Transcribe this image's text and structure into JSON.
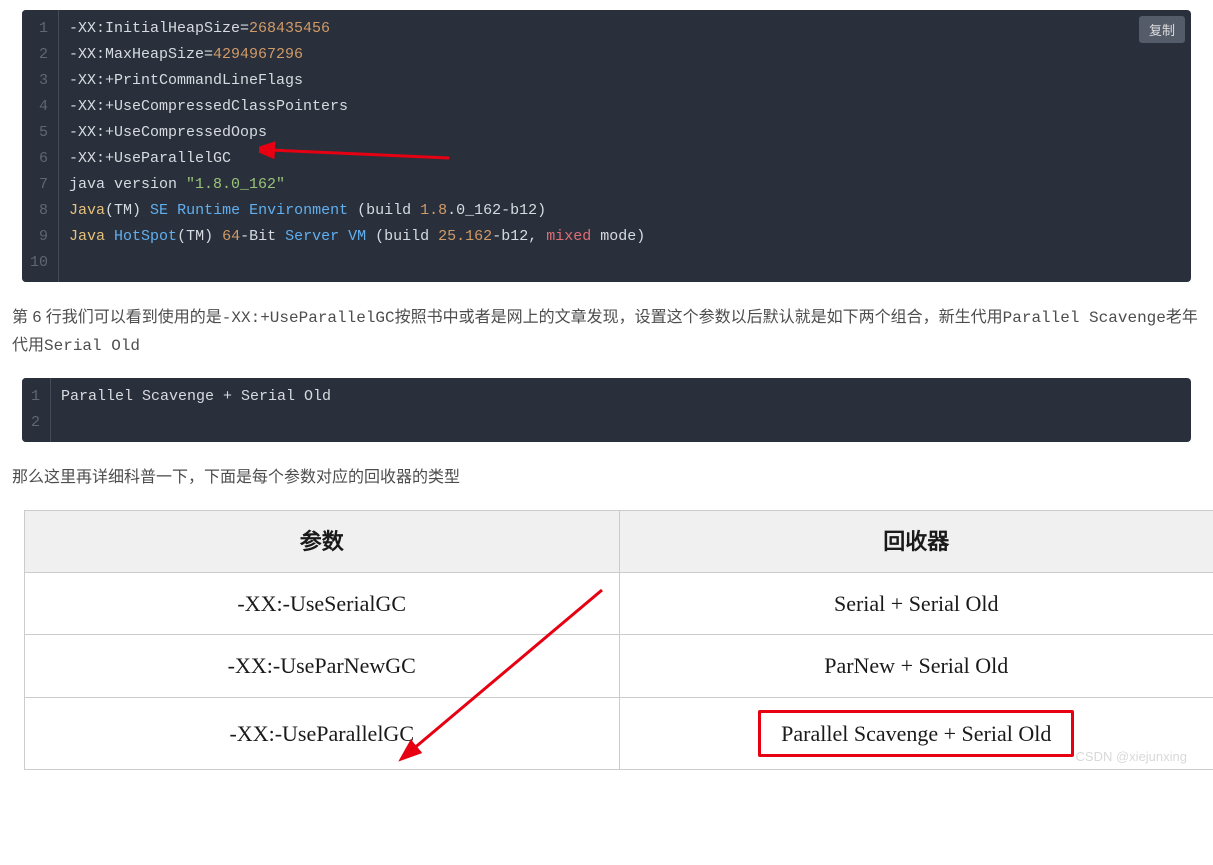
{
  "copy_label": "复制",
  "code1": {
    "line1_a": "-XX:InitialHeapSize=",
    "line1_b": "268435456",
    "line2_a": "-XX:MaxHeapSize=",
    "line2_b": "4294967296",
    "line3": "-XX:+PrintCommandLineFlags",
    "line4": "-XX:+UseCompressedClassPointers",
    "line5": "-XX:+UseCompressedOops",
    "line6": "-XX:+UseParallelGC",
    "line7_a": "java version ",
    "line7_b": "\"1.8.0_162\"",
    "line8_a": "Java",
    "line8_b": "(TM) ",
    "line8_c": "SE",
    "line8_d": " ",
    "line8_e": "Runtime",
    "line8_f": " ",
    "line8_g": "Environment",
    "line8_h": " (build ",
    "line8_i": "1.8",
    "line8_j": ".0_162-b12)",
    "line9_a": "Java",
    "line9_b": " ",
    "line9_c": "HotSpot",
    "line9_d": "(TM) ",
    "line9_e": "64",
    "line9_f": "-Bit ",
    "line9_g": "Server",
    "line9_h": " ",
    "line9_i": "VM",
    "line9_j": " (build ",
    "line9_k": "25.162",
    "line9_l": "-b12, ",
    "line9_m": "mixed",
    "line9_n": " mode)"
  },
  "para1_a": "第 6 行我们可以看到使用的是",
  "para1_b": "-XX:+UseParallelGC",
  "para1_c": "按照书中或者是网上的文章发现，设置这个参数以后默认就是如下两个组合，新生代用",
  "para1_d": "Parallel Scavenge",
  "para1_e": "老年代用",
  "para1_f": "Serial Old",
  "code2_line1": "Parallel Scavenge + Serial Old",
  "para2": "那么这里再详细科普一下，下面是每个参数对应的回收器的类型",
  "table": {
    "header1": "参数",
    "header2": "回收器",
    "r1c1": "-XX:-UseSerialGC",
    "r1c2": "Serial + Serial Old",
    "r2c1": "-XX:-UseParNewGC",
    "r2c2": "ParNew + Serial Old",
    "r3c1": "-XX:-UseParallelGC",
    "r3c2": "Parallel Scavenge + Serial Old"
  },
  "watermark": "CSDN @xiejunxing"
}
